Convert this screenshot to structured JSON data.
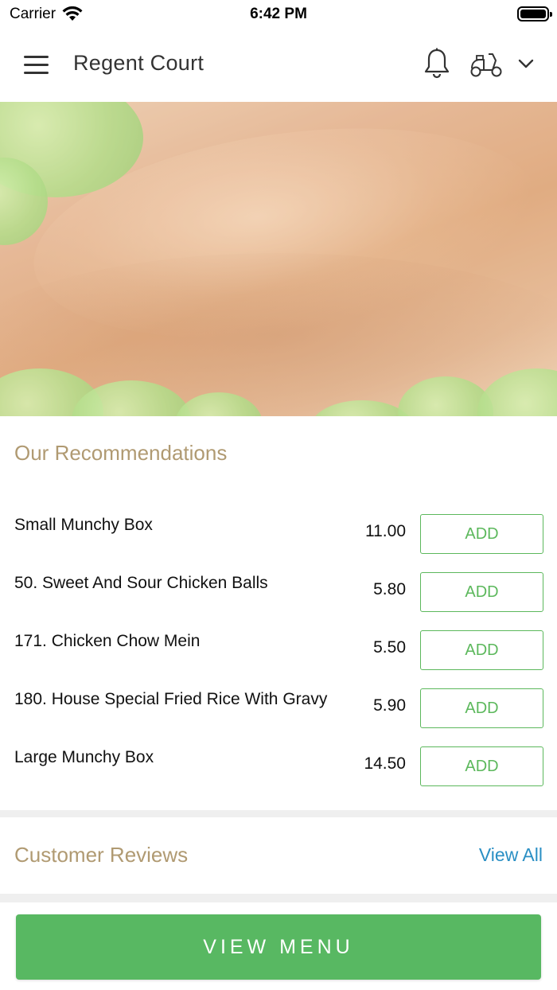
{
  "status_bar": {
    "carrier": "Carrier",
    "time": "6:42 PM"
  },
  "header": {
    "title": "Regent Court"
  },
  "recommendations": {
    "title": "Our Recommendations",
    "add_label": "ADD",
    "items": [
      {
        "name": "Small Munchy Box",
        "price": "11.00"
      },
      {
        "name": "50. Sweet And Sour Chicken Balls",
        "price": "5.80"
      },
      {
        "name": "171. Chicken Chow Mein",
        "price": "5.50"
      },
      {
        "name": "180. House Special Fried Rice With Gravy",
        "price": "5.90"
      },
      {
        "name": "Large Munchy Box",
        "price": "14.50"
      }
    ]
  },
  "reviews": {
    "title": "Customer Reviews",
    "view_all": "View All"
  },
  "cta": {
    "view_menu": "VIEW MENU"
  },
  "colors": {
    "accent_green": "#58b862",
    "section_title": "#b09a72",
    "link_blue": "#2a8fc4"
  }
}
